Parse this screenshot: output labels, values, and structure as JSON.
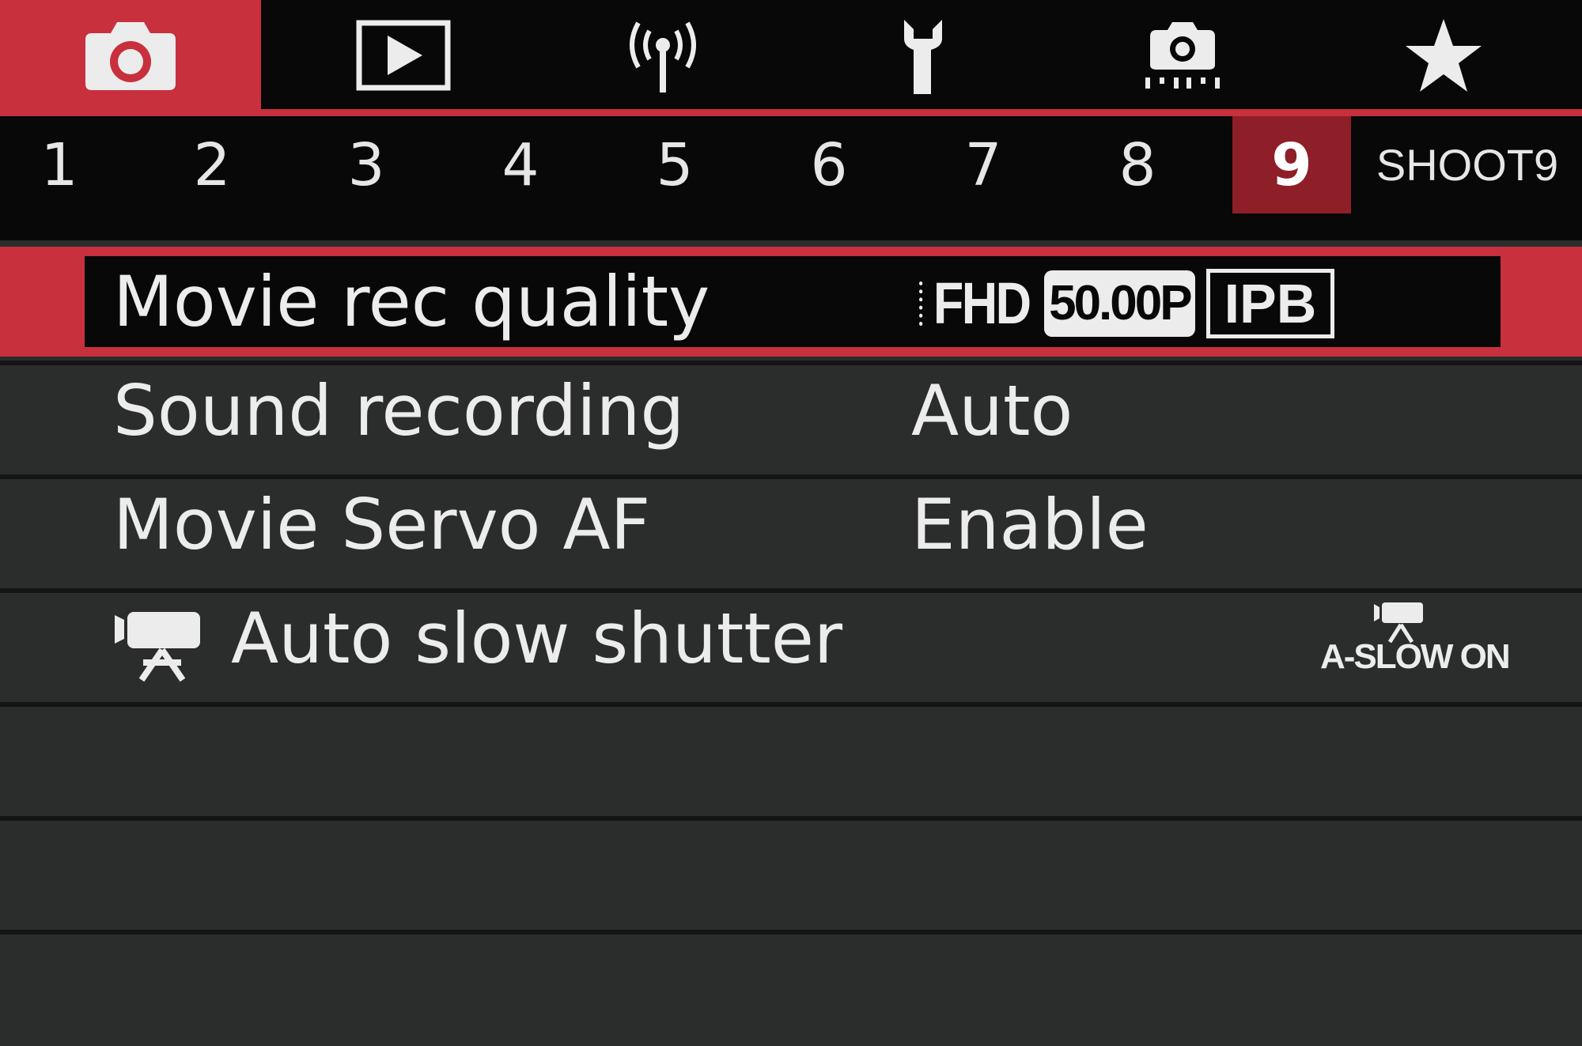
{
  "main_tabs": [
    {
      "name": "shooting",
      "icon": "camera-icon",
      "active": true
    },
    {
      "name": "playback",
      "icon": "playback-icon",
      "active": false
    },
    {
      "name": "wireless",
      "icon": "wireless-icon",
      "active": false
    },
    {
      "name": "setup",
      "icon": "wrench-icon",
      "active": false
    },
    {
      "name": "custom-functions",
      "icon": "custom-camera-icon",
      "active": false
    },
    {
      "name": "my-menu",
      "icon": "star-icon",
      "active": false
    }
  ],
  "sub_tabs": [
    "1",
    "2",
    "3",
    "4",
    "5",
    "6",
    "7",
    "8",
    "9"
  ],
  "active_sub_tab": "9",
  "page_label": "SHOOT9",
  "menu": {
    "movie_rec_quality": {
      "label": "Movie rec quality",
      "size": "FHD",
      "frame_rate": "50.00P",
      "compression": "IPB"
    },
    "sound_recording": {
      "label": "Sound recording",
      "value": "Auto"
    },
    "movie_servo_af": {
      "label": "Movie Servo AF",
      "value": "Enable"
    },
    "auto_slow_shutter": {
      "label": "Auto slow shutter",
      "icon": "movie-camera-icon",
      "value": "A-SLOW ON"
    }
  },
  "colors": {
    "accent_red": "#c8303d",
    "active_subtab": "#8e1e28",
    "background": "#2b2d2c",
    "bar_black": "#080808",
    "text": "#ececec"
  }
}
